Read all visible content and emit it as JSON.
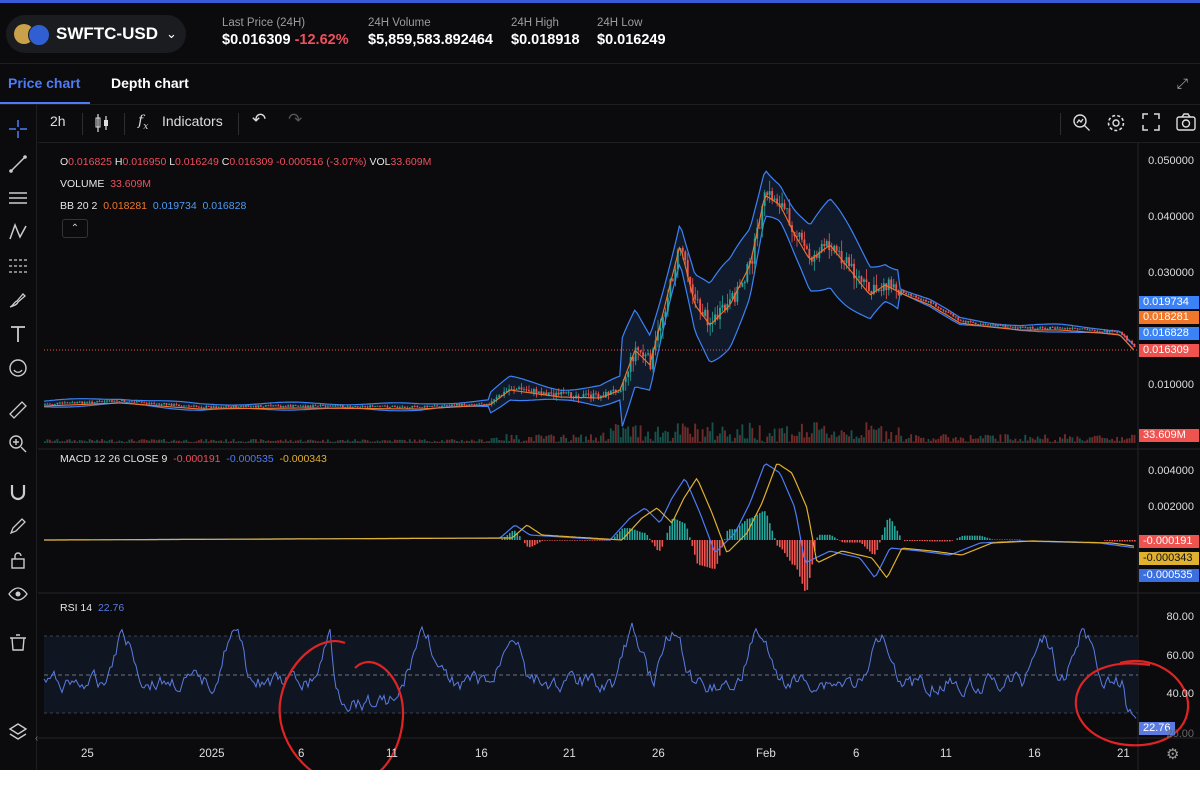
{
  "header": {
    "pair": "SWFTC-USD",
    "last_price_label": "Last Price (24H)",
    "last_price": "$0.016309",
    "change": "-12.62%",
    "volume_label": "24H Volume",
    "volume": "$5,859,583.892464",
    "high_label": "24H High",
    "high": "$0.018918",
    "low_label": "24H Low",
    "low": "$0.016249"
  },
  "tabs": {
    "price": "Price chart",
    "depth": "Depth chart"
  },
  "toolbar": {
    "interval": "2h",
    "indicators": "Indicators"
  },
  "legend": {
    "o_label": "O",
    "o": "0.016825",
    "h_label": "H",
    "h": "0.016950",
    "l_label": "L",
    "l": "0.016249",
    "c_label": "C",
    "c": "0.016309",
    "chg": "-0.000516 (-3.07%)",
    "vol_label": "VOL",
    "vol": "33.609M",
    "volume_name": "VOLUME",
    "volume_val": "33.609M",
    "bb_name": "BB 20 2",
    "bb1": "0.018281",
    "bb2": "0.019734",
    "bb3": "0.016828",
    "macd_name": "MACD 12 26 CLOSE 9",
    "macd1": "-0.000191",
    "macd2": "-0.000535",
    "macd3": "-0.000343",
    "rsi_name": "RSI 14",
    "rsi_val": "22.76"
  },
  "price_axis": [
    "0.050000",
    "0.040000",
    "0.030000",
    "0.010000"
  ],
  "price_badges": {
    "bb_upper": "0.019734",
    "bb_mid": "0.018281",
    "bb_lower": "0.016828",
    "last": "0.016309",
    "vol": "33.609M"
  },
  "macd_axis": [
    "0.004000",
    "0.002000"
  ],
  "macd_badges": {
    "m1": "-0.000191",
    "m2": "-0.000343",
    "m3": "-0.000535"
  },
  "rsi_axis": [
    "80.00",
    "60.00",
    "40.00"
  ],
  "rsi_badge": "22.76",
  "rsi_hidden_tick": "20.00",
  "time_axis": [
    "25",
    "2025",
    "6",
    "11",
    "16",
    "21",
    "26",
    "Feb",
    "6",
    "11",
    "16",
    "21"
  ],
  "colors": {
    "accent": "#4d7cf6",
    "up": "#26a69a",
    "down": "#ef5350",
    "bb_mid": "#f0762a",
    "bb_band": "#3b82f6",
    "rsi": "#5b7be0",
    "annotation": "#e02424"
  }
}
